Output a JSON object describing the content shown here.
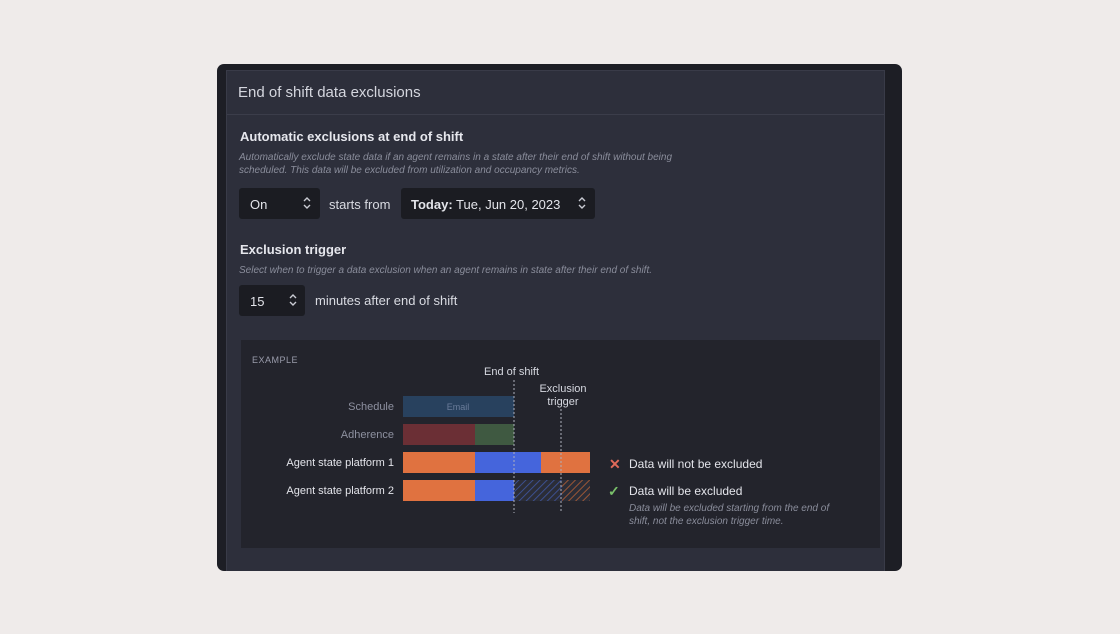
{
  "panel": {
    "title": "End of shift data exclusions"
  },
  "auto": {
    "title": "Automatic exclusions at end of shift",
    "desc_line1": "Automatically exclude state data if an agent remains in a state after their end of shift without being",
    "desc_line2": "scheduled. This data will be excluded from utilization and occupancy metrics.",
    "toggle_value": "On",
    "starts_from_label": "starts from",
    "date_prefix": "Today:",
    "date_value": "Tue, Jun 20, 2023"
  },
  "trigger": {
    "title": "Exclusion trigger",
    "desc": "Select when to trigger a data exclusion when an agent remains in state after their end of shift.",
    "minutes_value": "15",
    "minutes_label": "minutes after end of shift"
  },
  "example": {
    "label": "EXAMPLE",
    "end_of_shift": "End of shift",
    "exclusion_trigger_line1": "Exclusion",
    "exclusion_trigger_line2": "trigger",
    "rows": [
      "Schedule",
      "Adherence",
      "Agent state platform 1",
      "Agent state platform 2"
    ],
    "schedule_bar_label": "Email",
    "legend_not_excluded": "Data will not be excluded",
    "legend_excluded": "Data will be excluded",
    "legend_note_line1": "Data will be excluded starting from the end of",
    "legend_note_line2": "shift, not the exclusion trigger time."
  },
  "colors": {
    "orange": "#e07240",
    "blue": "#4565dc",
    "cross": "#e06a5a",
    "check": "#79c06a"
  }
}
